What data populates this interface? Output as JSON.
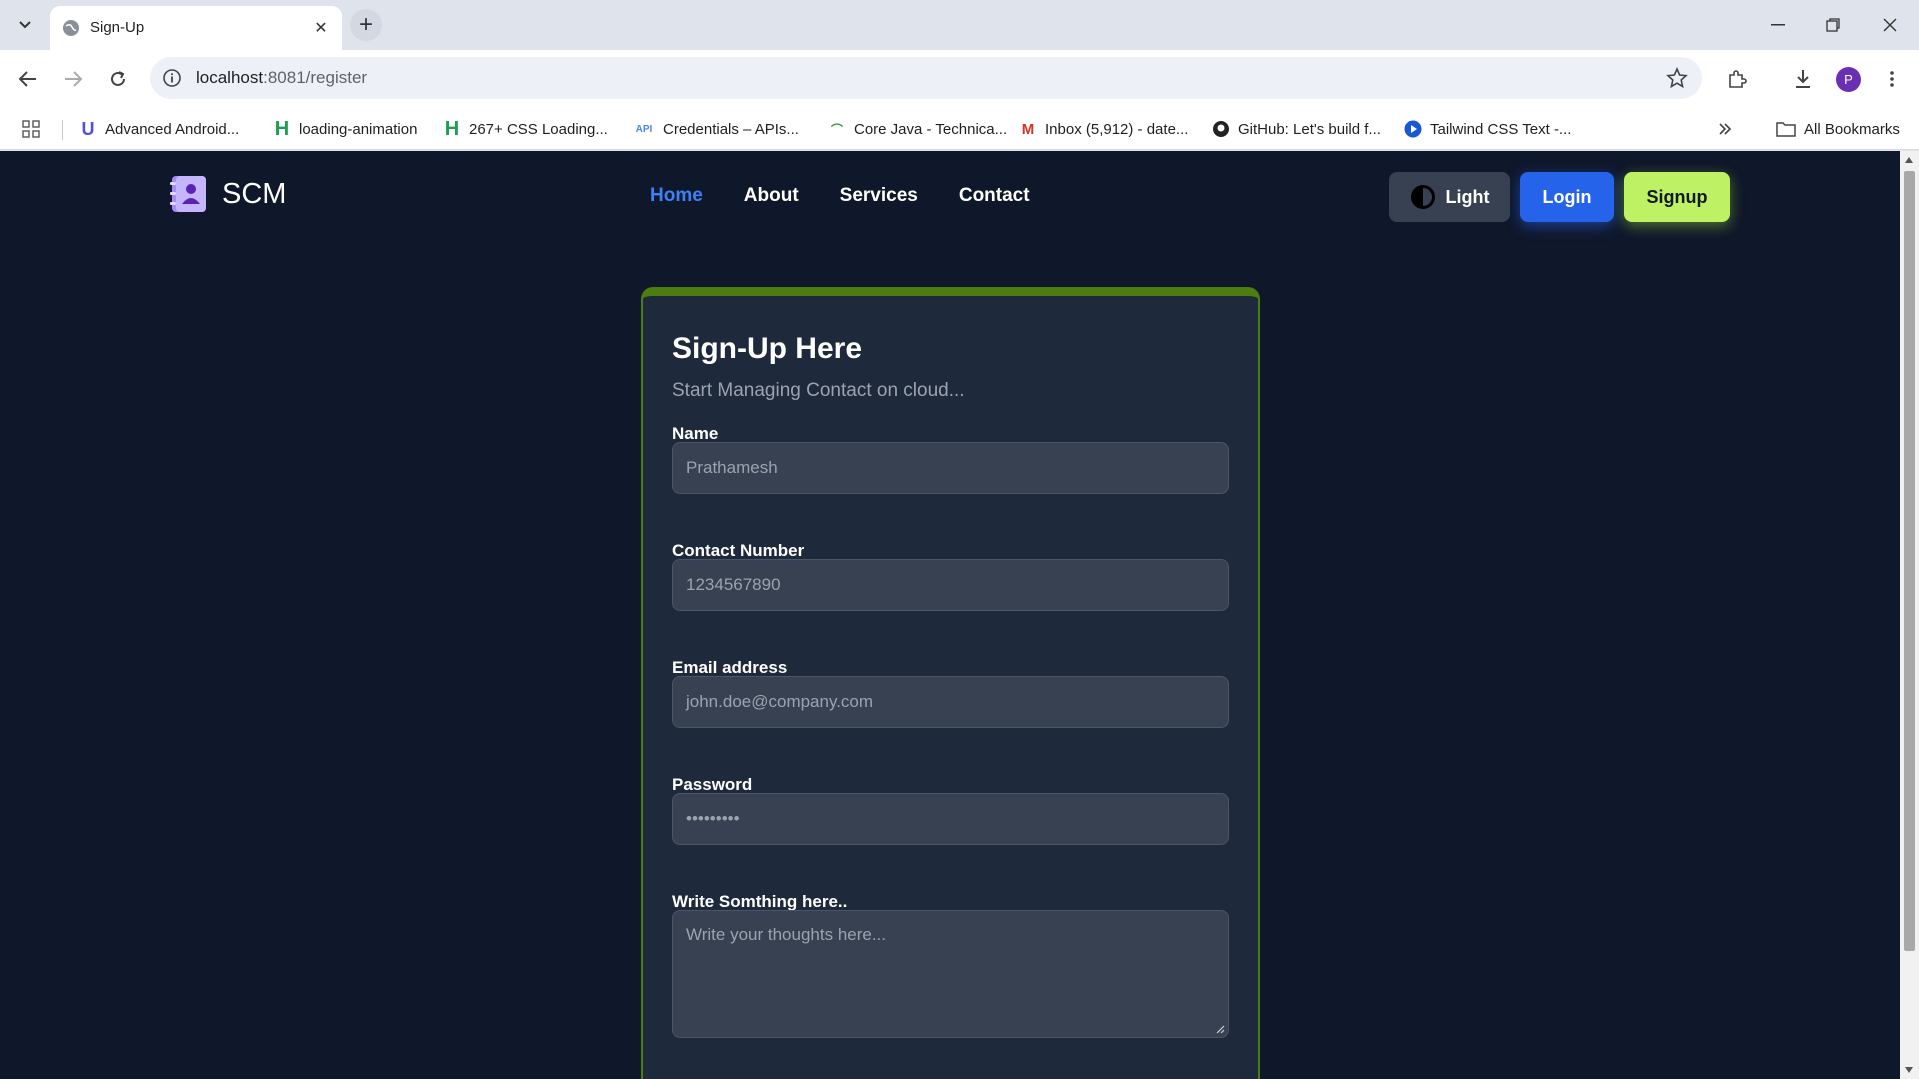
{
  "browser": {
    "tab_title": "Sign-Up",
    "url_host": "localhost",
    "url_rest": ":8081/register",
    "profile_initial": "P",
    "bookmarks": [
      {
        "label": "Advanced Android...",
        "icon": "u-logo-icon"
      },
      {
        "label": "loading-animation",
        "icon": "h-logo-icon"
      },
      {
        "label": "267+ CSS Loading...",
        "icon": "h-logo-icon"
      },
      {
        "label": "Credentials – APIs...",
        "icon": "api-icon"
      },
      {
        "label": "Core Java - Technica...",
        "icon": "leaf-icon"
      },
      {
        "label": "Inbox (5,912) - date...",
        "icon": "gmail-icon"
      },
      {
        "label": "GitHub: Let's build f...",
        "icon": "github-icon"
      },
      {
        "label": "Tailwind CSS Text -...",
        "icon": "play-icon"
      }
    ],
    "all_bookmarks_label": "All Bookmarks"
  },
  "site": {
    "brand": "SCM",
    "menu": [
      {
        "label": "Home",
        "active": true
      },
      {
        "label": "About",
        "active": false
      },
      {
        "label": "Services",
        "active": false
      },
      {
        "label": "Contact",
        "active": false
      }
    ],
    "theme_button": "Light",
    "login_button": "Login",
    "signup_button": "Signup"
  },
  "form": {
    "title": "Sign-Up Here",
    "subtitle": "Start Managing Contact on cloud...",
    "name_label": "Name",
    "name_placeholder": "Prathamesh",
    "phone_label": "Contact Number",
    "phone_placeholder": "1234567890",
    "email_label": "Email address",
    "email_placeholder": "john.doe@company.com",
    "password_label": "Password",
    "password_placeholder": "•••••••••",
    "about_label": "Write Somthing here..",
    "about_placeholder": "Write your thoughts here..."
  },
  "colors": {
    "page_bg": "#0f172a",
    "card_bg": "#1e293b",
    "card_border": "#4d7c0f",
    "accent_blue": "#3b82f6",
    "login_bg": "#2563eb",
    "signup_bg": "#bef264"
  }
}
